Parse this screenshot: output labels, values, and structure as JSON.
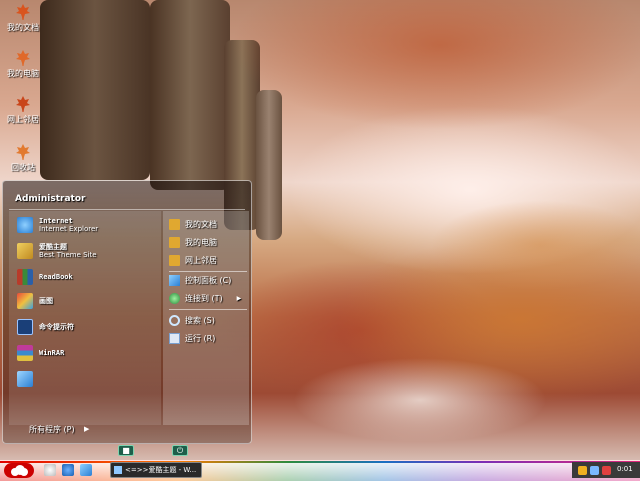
{
  "desktop": {
    "icons": [
      {
        "label": "我的文档",
        "icon": "maple-leaf-icon"
      },
      {
        "label": "我的电脑",
        "icon": "maple-leaf-icon"
      },
      {
        "label": "网上邻居",
        "icon": "maple-leaf-icon"
      },
      {
        "label": "回收站",
        "icon": "maple-leaf-icon"
      }
    ]
  },
  "start_menu": {
    "user": "Administrator",
    "pinned": [
      {
        "title": "Internet",
        "subtitle": "Internet Explorer",
        "icon": "internet-explorer-icon",
        "color": "#2a7fd4"
      },
      {
        "title": "爱酷主题",
        "subtitle": "Best Theme Site",
        "icon": "theme-site-icon",
        "color": "#d8b23a"
      }
    ],
    "programs": [
      {
        "title": "ReadBook",
        "icon": "books-icon",
        "color": "#b83b2a"
      },
      {
        "title": "画图",
        "icon": "paint-icon",
        "color": "#c9a238"
      },
      {
        "title": "命令提示符",
        "icon": "command-prompt-icon",
        "color": "#2a5fa8"
      },
      {
        "title": "WinRAR",
        "icon": "winrar-icon",
        "color": "#7a3aa0"
      },
      {
        "title": "",
        "icon": "notepad-icon",
        "color": "#3a8fd4"
      }
    ],
    "places": [
      {
        "label": "我的文档",
        "icon": "folder-icon"
      },
      {
        "label": "我的电脑",
        "icon": "computer-icon"
      },
      {
        "label": "网上邻居",
        "icon": "network-icon"
      }
    ],
    "settings": [
      {
        "label": "控制面板 (C)",
        "icon": "control-panel-icon"
      },
      {
        "label": "连接到 (T)",
        "icon": "connect-icon"
      }
    ],
    "tools": [
      {
        "label": "搜索 (S)",
        "icon": "search-icon"
      },
      {
        "label": "运行 (R)",
        "icon": "run-icon"
      }
    ],
    "all_programs": "所有程序 (P)",
    "logoff_icon": "logoff-icon",
    "shutdown_icon": "power-icon"
  },
  "taskbar": {
    "start_icon": "start-cloud-icon",
    "quick_launch": [
      "ie-quicklaunch-icon",
      "media-quicklaunch-icon",
      "desktop-quicklaunch-icon"
    ],
    "task_label": "<=>>爱酷主题 - W...",
    "tray_icons": [
      "network-tray-icon",
      "volume-tray-icon",
      "security-tray-icon"
    ],
    "clock": "0:01"
  },
  "colors": {
    "taskbar_red": "#e00000",
    "leaf": "#d9541e",
    "menu_bg": "rgba(30,20,18,0.55)"
  }
}
